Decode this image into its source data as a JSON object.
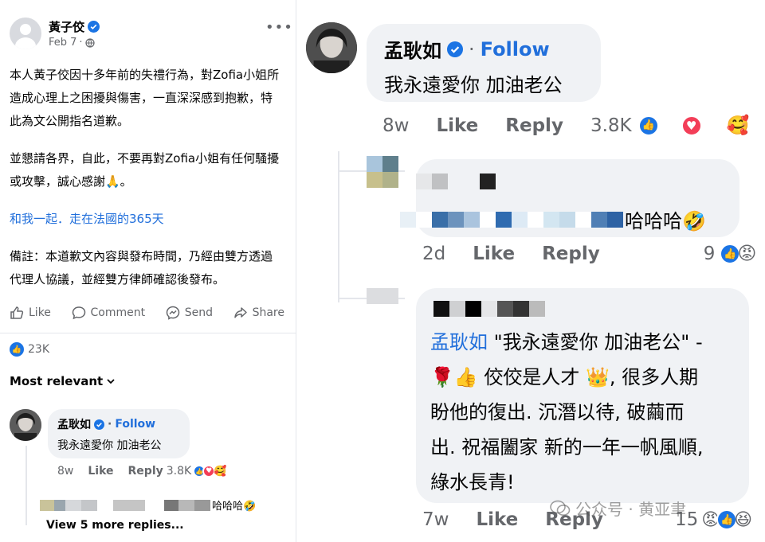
{
  "post": {
    "author": "黃子佼",
    "date": "Feb 7",
    "more_icon": "more-dots-icon",
    "paragraphs": [
      "本人黃子佼因十多年前的失禮行為，對Zofia小姐所造成心理上之困擾與傷害，一直深深感到抱歉，特此為文公開指名道歉。",
      "並懇請各界，自此，不要再對Zofia小姐有任何騷擾或攻擊，誠心感謝🙏。",
      "和我一起．走在法國的365天",
      "備註：本道歉文內容與發布時間，乃經由雙方透過代理人協議，並經雙方律師確認後發布。"
    ],
    "actions": {
      "like": "Like",
      "comment": "Comment",
      "send": "Send",
      "share": "Share"
    },
    "reaction_count": "23K",
    "sort_label": "Most relevant"
  },
  "left_comment": {
    "name": "孟耿如",
    "follow": "Follow",
    "text": "我永遠愛你 加油老公",
    "age": "8w",
    "like": "Like",
    "reply": "Reply",
    "count": "3.8K",
    "reply_snippet": "哈哈哈🤣",
    "view_more": "View 5 more replies..."
  },
  "right_comment": {
    "name": "孟耿如",
    "dot": "·",
    "follow": "Follow",
    "text": "我永遠愛你 加油老公",
    "age": "8w",
    "like": "Like",
    "reply": "Reply",
    "count": "3.8K"
  },
  "reply1": {
    "text": "哈哈哈🤣",
    "age": "2d",
    "like": "Like",
    "reply": "Reply",
    "count": "9"
  },
  "reply2": {
    "mention": "孟耿如",
    "quote": " \"我永遠愛你 加油老公\" -",
    "line2": "🌹👍 佼佼是人才 👑, 很多人期",
    "line3": "盼他的復出. 沉潛以待, 破繭而",
    "line4": "出. 祝福闔家 新的一年一帆風順,",
    "line5": "綠水長青!",
    "age": "7w",
    "like": "Like",
    "reply": "Reply",
    "count": "15"
  },
  "watermark": "公众号 · 黄亚聿",
  "colors": {
    "facebook_blue": "#216fdb",
    "bubble_bg": "#f0f2f5",
    "meta_grey": "#65676b",
    "like_blue": "#1b74e4",
    "love_red": "#f33e58",
    "angry_orange": "#e9710f"
  }
}
